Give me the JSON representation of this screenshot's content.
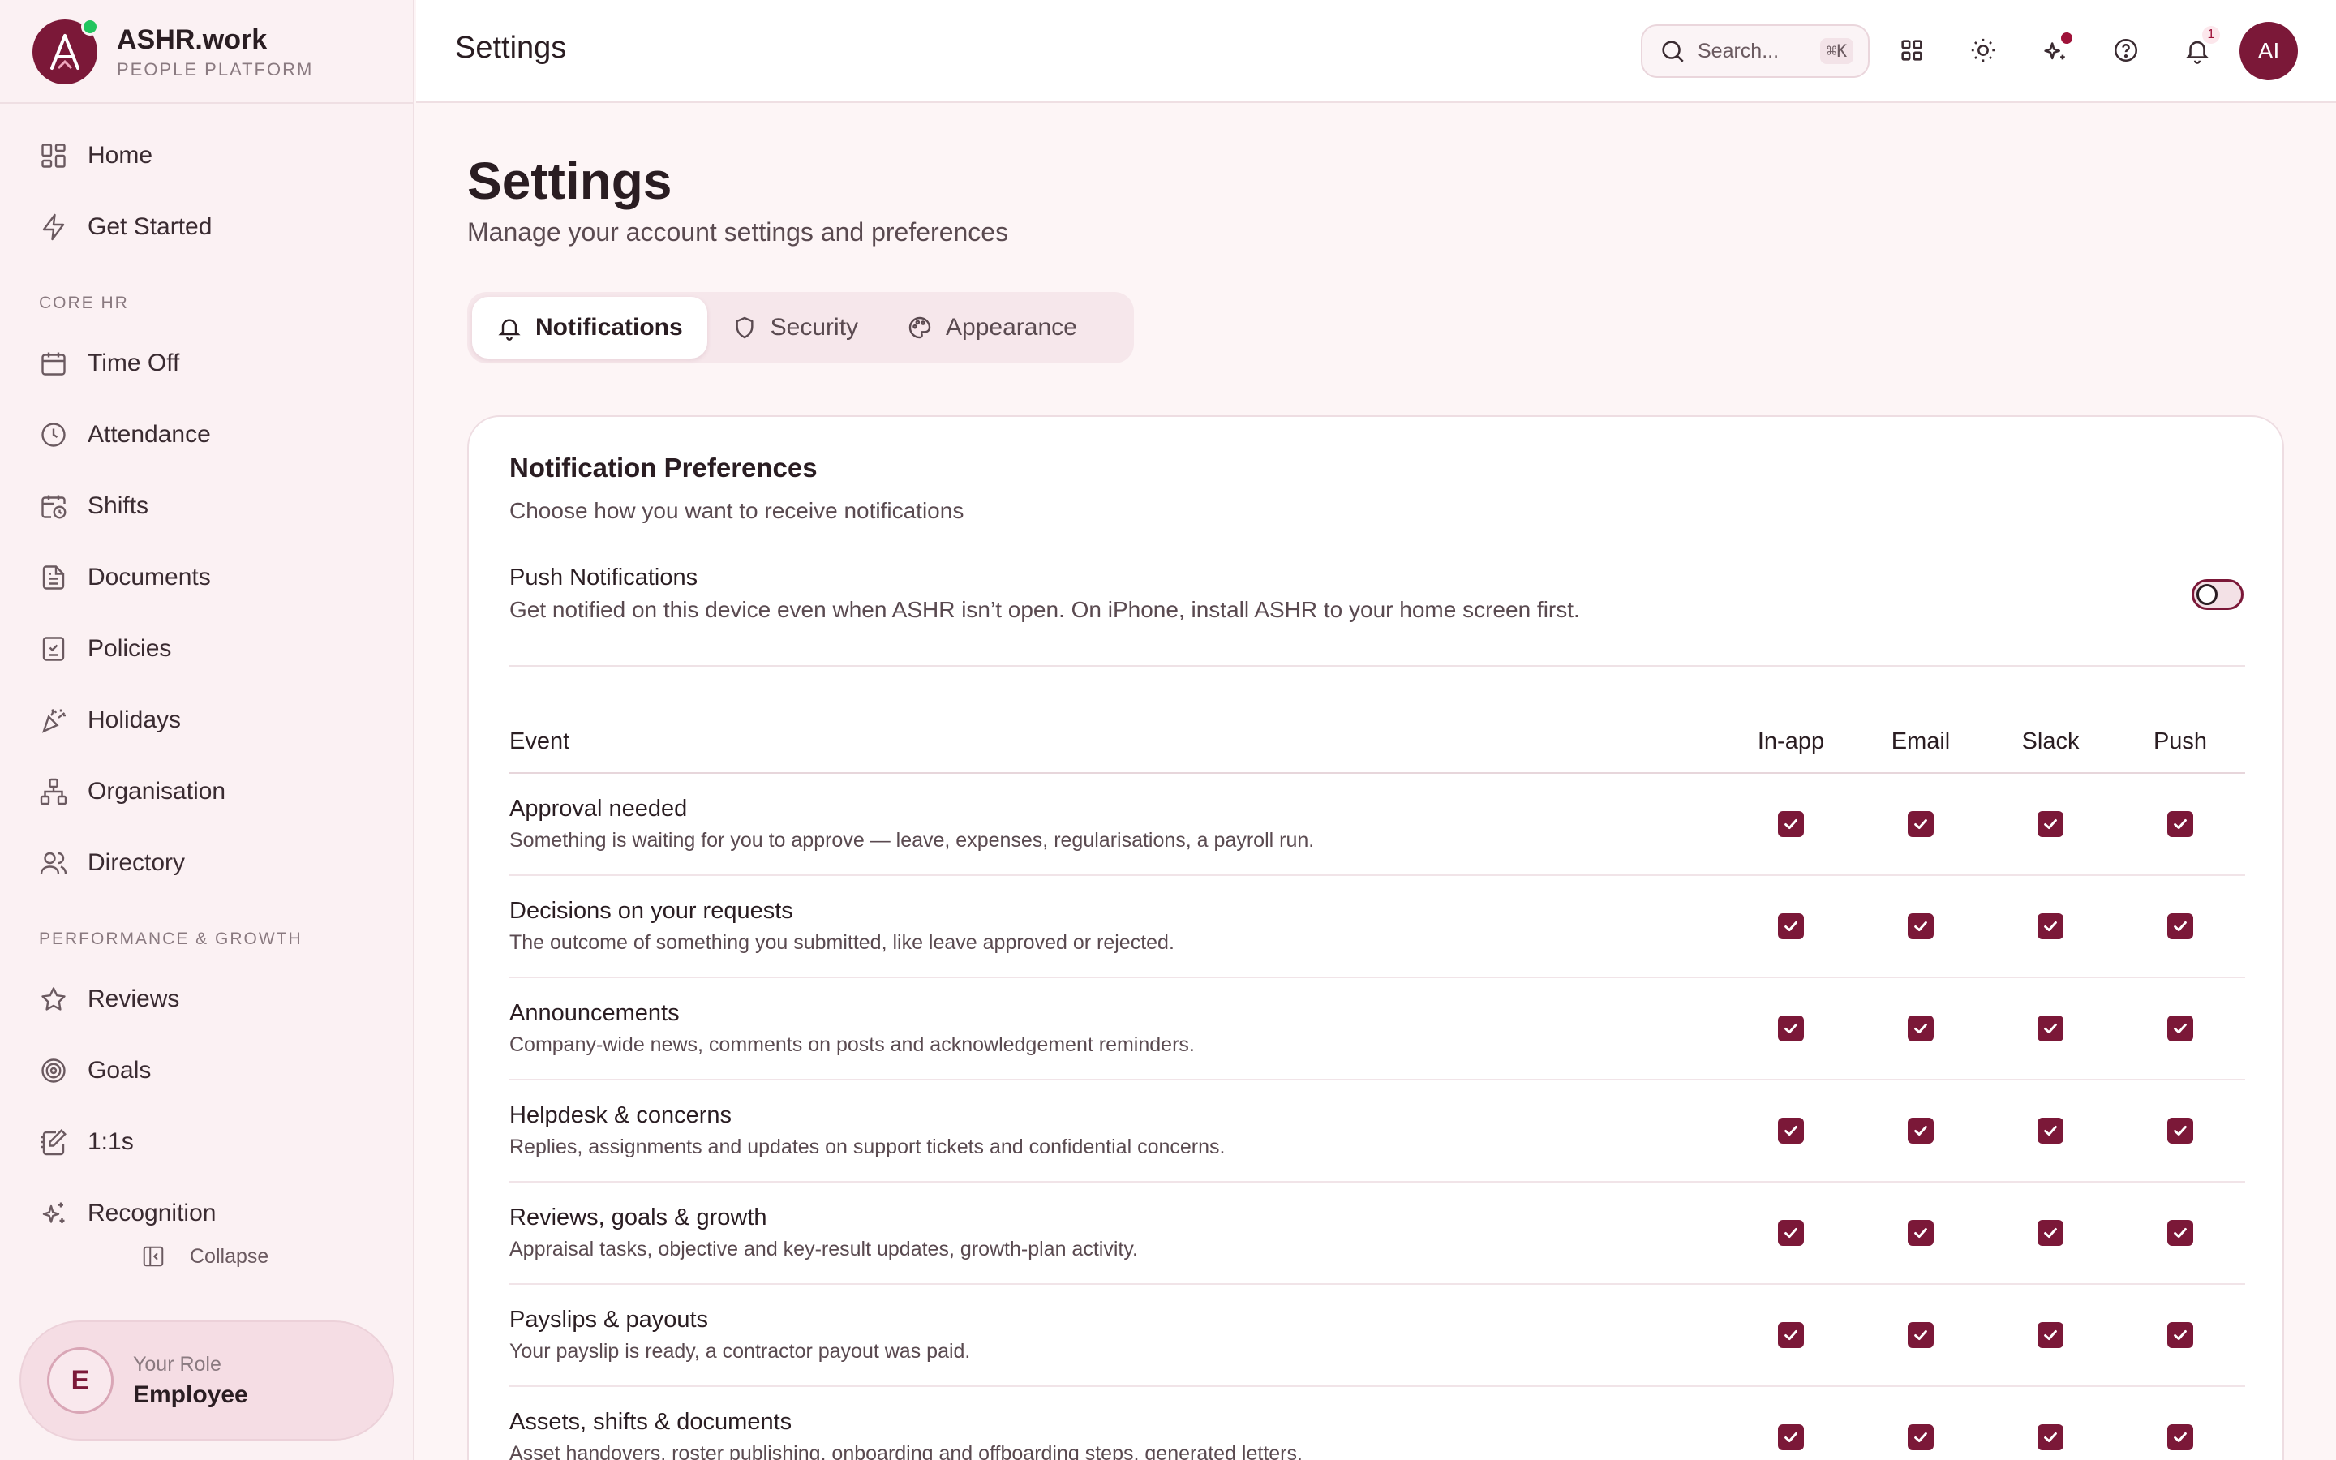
{
  "brand": {
    "name": "ASHR.work",
    "subtitle": "PEOPLE PLATFORM",
    "logo_letter": "A"
  },
  "sidebar": {
    "items_top": [
      {
        "label": "Home",
        "icon": "grid-icon"
      },
      {
        "label": "Get Started",
        "icon": "bolt-icon"
      }
    ],
    "section_core": "CORE HR",
    "items_core": [
      {
        "label": "Time Off",
        "icon": "calendar-icon"
      },
      {
        "label": "Attendance",
        "icon": "clock-icon"
      },
      {
        "label": "Shifts",
        "icon": "calendar-clock-icon"
      },
      {
        "label": "Documents",
        "icon": "document-icon"
      },
      {
        "label": "Policies",
        "icon": "policy-book-icon"
      },
      {
        "label": "Holidays",
        "icon": "party-popper-icon"
      },
      {
        "label": "Organisation",
        "icon": "org-chart-icon"
      },
      {
        "label": "Directory",
        "icon": "users-icon"
      }
    ],
    "section_perf": "PERFORMANCE & GROWTH",
    "items_perf": [
      {
        "label": "Reviews",
        "icon": "star-icon"
      },
      {
        "label": "Goals",
        "icon": "target-icon"
      },
      {
        "label": "1:1s",
        "icon": "notebook-pen-icon"
      },
      {
        "label": "Recognition",
        "icon": "sparkles-icon"
      }
    ],
    "collapse_label": "Collapse",
    "role": {
      "avatar_letter": "E",
      "label": "Your Role",
      "value": "Employee"
    }
  },
  "header": {
    "title": "Settings",
    "search_placeholder": "Search...",
    "search_shortcut": "⌘K",
    "notification_count": "1",
    "user_initials": "AI"
  },
  "page": {
    "title": "Settings",
    "subtitle": "Manage your account settings and preferences"
  },
  "tabs": [
    {
      "label": "Notifications",
      "active": true
    },
    {
      "label": "Security",
      "active": false
    },
    {
      "label": "Appearance",
      "active": false
    }
  ],
  "notifications": {
    "title": "Notification Preferences",
    "subtitle": "Choose how you want to receive notifications",
    "push": {
      "title": "Push Notifications",
      "description": "Get notified on this device even when ASHR isn’t open. On iPhone, install ASHR to your home screen first.",
      "enabled": false
    },
    "columns": [
      "Event",
      "In-app",
      "Email",
      "Slack",
      "Push"
    ],
    "rows": [
      {
        "title": "Approval needed",
        "description": "Something is waiting for you to approve — leave, expenses, regularisations, a payroll run.",
        "checked": [
          true,
          true,
          true,
          true
        ]
      },
      {
        "title": "Decisions on your requests",
        "description": "The outcome of something you submitted, like leave approved or rejected.",
        "checked": [
          true,
          true,
          true,
          true
        ]
      },
      {
        "title": "Announcements",
        "description": "Company-wide news, comments on posts and acknowledgement reminders.",
        "checked": [
          true,
          true,
          true,
          true
        ]
      },
      {
        "title": "Helpdesk & concerns",
        "description": "Replies, assignments and updates on support tickets and confidential concerns.",
        "checked": [
          true,
          true,
          true,
          true
        ]
      },
      {
        "title": "Reviews, goals & growth",
        "description": "Appraisal tasks, objective and key-result updates, growth-plan activity.",
        "checked": [
          true,
          true,
          true,
          true
        ]
      },
      {
        "title": "Payslips & payouts",
        "description": "Your payslip is ready, a contractor payout was paid.",
        "checked": [
          true,
          true,
          true,
          true
        ]
      },
      {
        "title": "Assets, shifts & documents",
        "description": "Asset handovers, roster publishing, onboarding and offboarding steps, generated letters.",
        "checked": [
          true,
          true,
          true,
          true
        ]
      }
    ]
  },
  "colors": {
    "accent": "#7b1838",
    "background": "#fdf5f6",
    "online": "#22c55e"
  }
}
